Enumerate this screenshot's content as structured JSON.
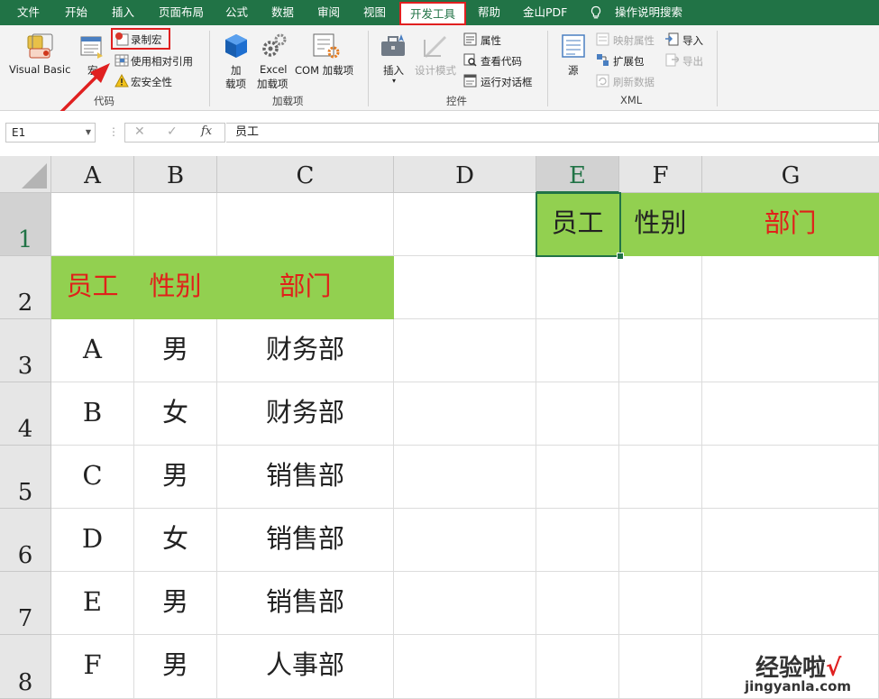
{
  "tabs": [
    {
      "label": "文件"
    },
    {
      "label": "开始"
    },
    {
      "label": "插入"
    },
    {
      "label": "页面布局"
    },
    {
      "label": "公式"
    },
    {
      "label": "数据"
    },
    {
      "label": "审阅"
    },
    {
      "label": "视图"
    },
    {
      "label": "开发工具"
    },
    {
      "label": "帮助"
    },
    {
      "label": "金山PDF"
    },
    {
      "label": "操作说明搜索"
    }
  ],
  "ribbon": {
    "code": {
      "visual_basic": "Visual Basic",
      "macros": "宏",
      "record_macro": "录制宏",
      "use_relative": "使用相对引用",
      "macro_security": "宏安全性",
      "group_label": "代码"
    },
    "addins": {
      "addins_line1": "加",
      "addins_line2": "载项",
      "excel_line1": "Excel",
      "excel_line2": "加载项",
      "com": "COM 加载项",
      "group_label": "加载项"
    },
    "controls": {
      "insert": "插入",
      "design_mode": "设计模式",
      "properties": "属性",
      "view_code": "查看代码",
      "run_dialog": "运行对话框",
      "group_label": "控件"
    },
    "xml": {
      "source": "源",
      "map_props": "映射属性",
      "expansion": "扩展包",
      "refresh": "刷新数据",
      "import": "导入",
      "export": "导出",
      "group_label": "XML"
    }
  },
  "formula_bar": {
    "name_box": "E1",
    "cancel": "✕",
    "enter": "✓",
    "fx": "fx",
    "value": "员工"
  },
  "sheet": {
    "columns": [
      "A",
      "B",
      "C",
      "D",
      "E",
      "F",
      "G"
    ],
    "rows": [
      "1",
      "2",
      "3",
      "4",
      "5",
      "6",
      "7",
      "8"
    ],
    "selected_cell": "E1",
    "cells": {
      "E1": "员工",
      "F1": "性别",
      "G1": "部门",
      "A2": "员工",
      "B2": "性别",
      "C2": "部门",
      "A3": "A",
      "B3": "男",
      "C3": "财务部",
      "A4": "B",
      "B4": "女",
      "C4": "财务部",
      "A5": "C",
      "B5": "男",
      "C5": "销售部",
      "A6": "D",
      "B6": "女",
      "C6": "销售部",
      "A7": "E",
      "B7": "男",
      "C7": "销售部",
      "A8": "F",
      "B8": "男",
      "C8": "人事部"
    }
  },
  "watermark": {
    "text": "经验啦",
    "check": "√",
    "url": "jingyanla.com"
  },
  "colors": {
    "excel_green": "#217346",
    "header_fill": "#92d050",
    "red_text": "#e0211a",
    "highlight": "#e02020"
  }
}
